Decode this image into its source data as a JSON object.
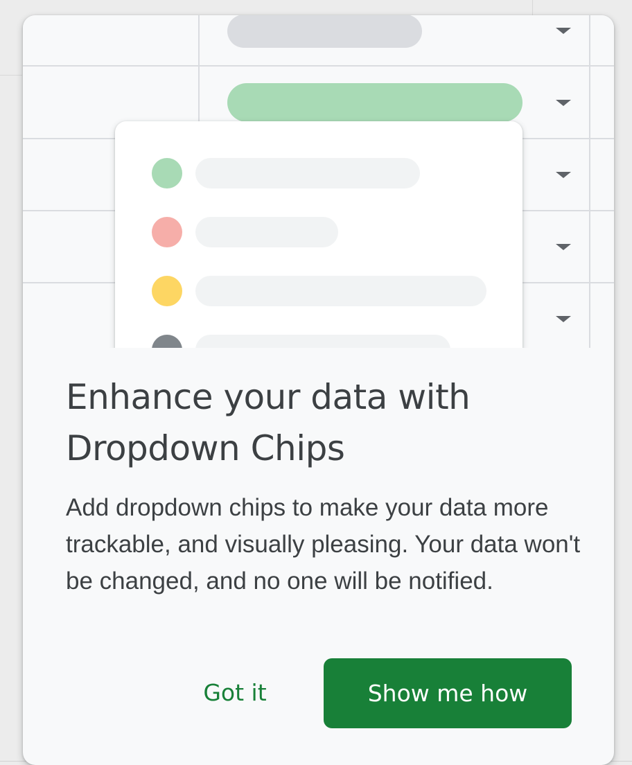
{
  "dialog": {
    "title_line1": "Enhance your data with",
    "title_line2": "Dropdown Chips",
    "body": "Add dropdown chips to make your data more trackable, and visually pleasing. Your data won't be changed, and no one will be notified.",
    "secondary_button": "Got it",
    "primary_button": "Show me how"
  },
  "illustration": {
    "chip_colors": [
      "#dadce0",
      "#a8dab5"
    ],
    "option_dot_colors": [
      "#a8dab5",
      "#f6aea9",
      "#fdd663",
      "#80868b"
    ],
    "option_bar_color": "#f1f3f4",
    "caret_icon": "arrow-drop-down-icon"
  },
  "colors": {
    "accent": "#188038",
    "text": "#3c4043",
    "card_background": "#f8f9fa"
  }
}
